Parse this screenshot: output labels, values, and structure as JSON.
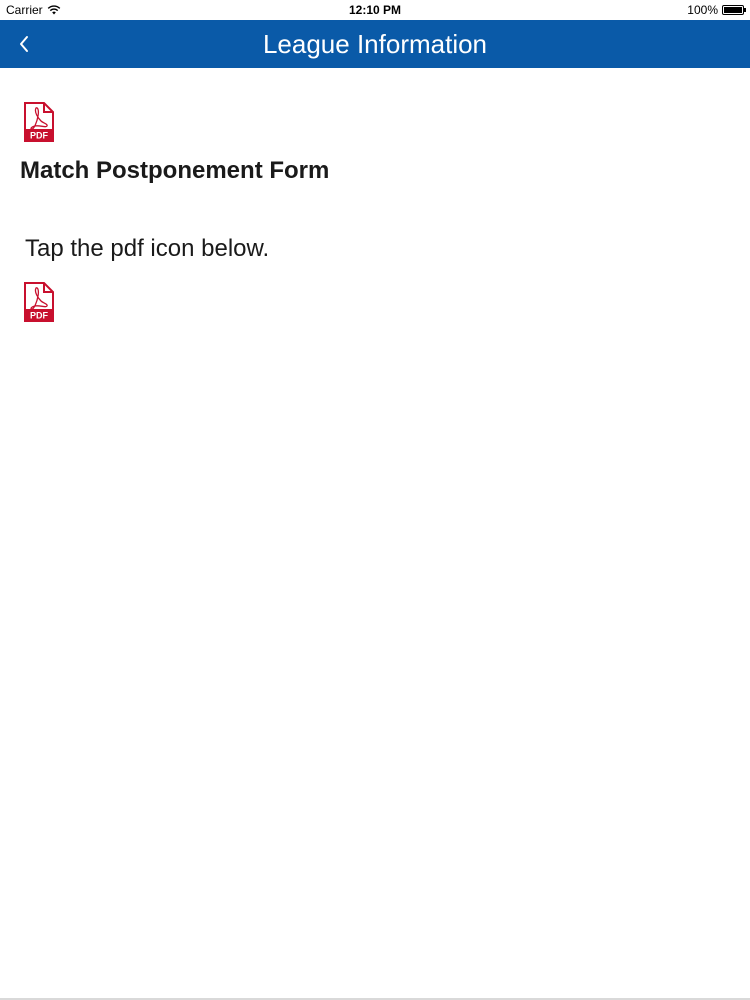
{
  "status_bar": {
    "carrier": "Carrier",
    "time": "12:10 PM",
    "battery": "100%"
  },
  "nav": {
    "title": "League Information",
    "back_icon": "chevron-left-icon",
    "background_color": "#0a5aa8"
  },
  "content": {
    "header_icon": "pdf-icon",
    "form_title": "Match Postponement Form",
    "instruction": "Tap the pdf icon below.",
    "link_icon": "pdf-icon",
    "pdf_label": "PDF",
    "pdf_color": "#c8102e"
  }
}
